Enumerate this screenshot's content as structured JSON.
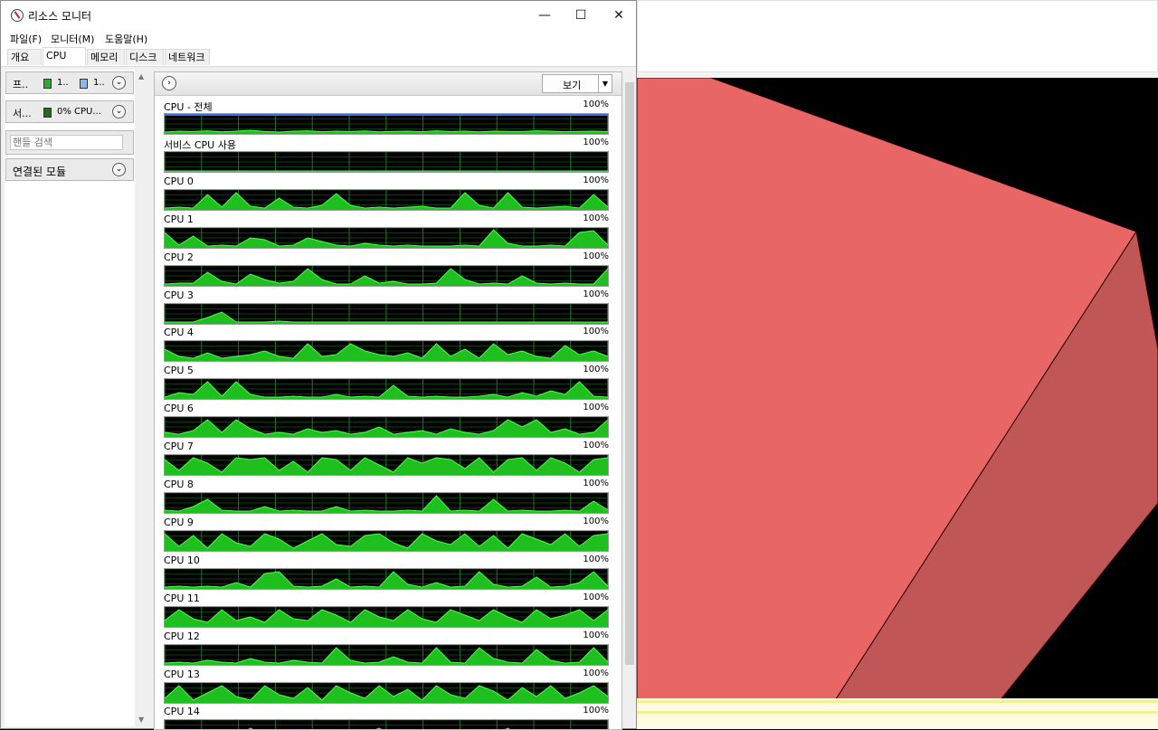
{
  "window": {
    "title": "리소스 모니터",
    "minimize_glyph": "—",
    "maximize_glyph": "☐",
    "close_glyph": "✕"
  },
  "menu": [
    "파일(F)",
    "모니터(M)",
    "도움말(H)"
  ],
  "tabs": [
    {
      "label": "개요",
      "active": false
    },
    {
      "label": "CPU",
      "active": true
    },
    {
      "label": "메모리",
      "active": false
    },
    {
      "label": "디스크",
      "active": false
    },
    {
      "label": "네트워크",
      "active": false
    }
  ],
  "left_panel": {
    "processes": {
      "label": "프..",
      "value1": "1..",
      "value2": "1..",
      "color1": "#2dab2d",
      "color2": "#8ab9f0"
    },
    "services": {
      "label": "서...",
      "value": "0% CPU...",
      "color": "#1f6e1f"
    },
    "handle_search": {
      "placeholder": "핸들 검색"
    },
    "modules": {
      "label": "연결된 모듈"
    }
  },
  "graph_panel": {
    "view_label": "보기",
    "graphs": [
      {
        "title": "CPU - 전체",
        "max": "100%",
        "values": [
          0.05,
          0.1,
          0.08,
          0.12,
          0.06,
          0.1,
          0.15,
          0.08,
          0.05,
          0.1,
          0.12,
          0.07,
          0.1,
          0.08,
          0.11,
          0.06,
          0.09,
          0.1,
          0.07,
          0.12,
          0.08,
          0.1,
          0.06,
          0.1,
          0.09,
          0.08,
          0.12,
          0.1,
          0.07,
          0.09,
          0.1,
          0.08
        ],
        "overlay": true
      },
      {
        "title": "서비스 CPU 사용",
        "max": "100%",
        "values": [
          0,
          0,
          0,
          0,
          0,
          0,
          0,
          0,
          0,
          0,
          0,
          0,
          0,
          0,
          0,
          0,
          0,
          0,
          0,
          0,
          0,
          0,
          0,
          0,
          0,
          0,
          0,
          0,
          0,
          0,
          0,
          0
        ]
      },
      {
        "title": "CPU 0",
        "max": "100%",
        "values": [
          0.05,
          0.1,
          0.05,
          0.8,
          0.1,
          0.9,
          0.15,
          0.05,
          0.6,
          0.1,
          0.05,
          0.2,
          0.85,
          0.2,
          0.05,
          0.1,
          0.05,
          0.1,
          0.15,
          0.05,
          0.05,
          0.9,
          0.2,
          0.05,
          0.9,
          0.1,
          0.05,
          0.1,
          0.15,
          0.05,
          0.8,
          0.1
        ]
      },
      {
        "title": "CPU 1",
        "max": "100%",
        "values": [
          0.8,
          0.1,
          0.6,
          0.05,
          0.1,
          0.05,
          0.5,
          0.4,
          0.05,
          0.1,
          0.5,
          0.3,
          0.1,
          0.05,
          0.2,
          0.1,
          0.05,
          0.1,
          0.05,
          0.05,
          0.05,
          0.1,
          0.05,
          0.95,
          0.2,
          0.05,
          0.05,
          0.1,
          0.05,
          0.8,
          0.9,
          0.1
        ]
      },
      {
        "title": "CPU 2",
        "max": "100%",
        "values": [
          0.05,
          0.1,
          0.1,
          0.7,
          0.2,
          0.05,
          0.6,
          0.3,
          0.1,
          0.2,
          0.9,
          0.3,
          0.05,
          0.05,
          0.5,
          0.1,
          0.2,
          0.05,
          0.05,
          0.1,
          0.9,
          0.3,
          0.05,
          0.1,
          0.05,
          0.5,
          0.1,
          0.05,
          0.1,
          0.05,
          0.05,
          0.9
        ]
      },
      {
        "title": "CPU 3",
        "max": "100%",
        "values": [
          0.05,
          0.05,
          0.05,
          0.3,
          0.6,
          0.05,
          0.05,
          0.05,
          0.1,
          0.05,
          0.05,
          0.05,
          0.05,
          0.05,
          0.05,
          0.05,
          0.05,
          0.05,
          0.05,
          0.05,
          0.05,
          0.05,
          0.05,
          0.05,
          0.05,
          0.05,
          0.05,
          0.05,
          0.05,
          0.05,
          0.05,
          0.05
        ]
      },
      {
        "title": "CPU 4",
        "max": "100%",
        "values": [
          0.6,
          0.2,
          0.1,
          0.4,
          0.1,
          0.2,
          0.3,
          0.5,
          0.2,
          0.1,
          0.9,
          0.2,
          0.3,
          0.9,
          0.5,
          0.3,
          0.2,
          0.4,
          0.1,
          0.9,
          0.2,
          0.6,
          0.1,
          0.9,
          0.3,
          0.5,
          0.2,
          0.1,
          0.8,
          0.3,
          0.5,
          0.2
        ]
      },
      {
        "title": "CPU 5",
        "max": "100%",
        "values": [
          0.05,
          0.3,
          0.2,
          0.9,
          0.1,
          0.9,
          0.2,
          0.05,
          0.05,
          0.1,
          0.05,
          0.05,
          0.2,
          0.05,
          0.1,
          0.05,
          0.7,
          0.1,
          0.05,
          0.1,
          0.05,
          0.05,
          0.1,
          0.2,
          0.05,
          0.3,
          0.1,
          0.4,
          0.2,
          0.9,
          0.1,
          0.05
        ]
      },
      {
        "title": "CPU 6",
        "max": "100%",
        "values": [
          0.2,
          0.1,
          0.3,
          0.9,
          0.2,
          0.9,
          0.4,
          0.1,
          0.2,
          0.1,
          0.4,
          0.2,
          0.3,
          0.1,
          0.2,
          0.5,
          0.1,
          0.2,
          0.3,
          0.1,
          0.4,
          0.2,
          0.1,
          0.3,
          0.9,
          0.5,
          0.9,
          0.2,
          0.4,
          0.1,
          0.2,
          0.9
        ]
      },
      {
        "title": "CPU 7",
        "max": "100%",
        "values": [
          0.8,
          0.2,
          0.9,
          0.6,
          0.1,
          0.9,
          0.8,
          0.9,
          0.2,
          0.7,
          0.1,
          0.9,
          0.8,
          0.2,
          0.9,
          0.5,
          0.1,
          0.9,
          0.6,
          0.9,
          0.8,
          0.3,
          0.9,
          0.1,
          0.8,
          0.9,
          0.2,
          0.9,
          0.6,
          0.1,
          0.8,
          0.9
        ]
      },
      {
        "title": "CPU 8",
        "max": "100%",
        "values": [
          0.1,
          0.05,
          0.3,
          0.7,
          0.1,
          0.05,
          0.05,
          0.3,
          0.05,
          0.1,
          0.05,
          0.05,
          0.3,
          0.05,
          0.1,
          0.05,
          0.05,
          0.1,
          0.05,
          0.9,
          0.05,
          0.1,
          0.05,
          0.7,
          0.05,
          0.1,
          0.05,
          0.05,
          0.1,
          0.05,
          0.6,
          0.1
        ]
      },
      {
        "title": "CPU 9",
        "max": "100%",
        "values": [
          0.9,
          0.2,
          0.8,
          0.1,
          0.9,
          0.4,
          0.2,
          0.9,
          0.6,
          0.1,
          0.5,
          0.9,
          0.3,
          0.2,
          0.8,
          0.9,
          0.4,
          0.1,
          0.9,
          0.5,
          0.3,
          0.9,
          0.2,
          0.8,
          0.1,
          0.9,
          0.6,
          0.3,
          0.9,
          0.2,
          0.8,
          0.9
        ]
      },
      {
        "title": "CPU 10",
        "max": "100%",
        "values": [
          0.05,
          0.1,
          0.05,
          0.1,
          0.05,
          0.3,
          0.05,
          0.8,
          0.9,
          0.1,
          0.05,
          0.1,
          0.5,
          0.05,
          0.1,
          0.05,
          0.9,
          0.2,
          0.05,
          0.3,
          0.05,
          0.1,
          0.9,
          0.2,
          0.05,
          0.1,
          0.6,
          0.05,
          0.1,
          0.3,
          0.9,
          0.1
        ]
      },
      {
        "title": "CPU 11",
        "max": "100%",
        "values": [
          0.3,
          0.9,
          0.4,
          0.2,
          0.9,
          0.3,
          0.5,
          0.2,
          0.9,
          0.4,
          0.3,
          0.9,
          0.6,
          0.2,
          0.9,
          0.5,
          0.3,
          0.9,
          0.4,
          0.2,
          0.9,
          0.6,
          0.3,
          0.9,
          0.5,
          0.2,
          0.9,
          0.4,
          0.6,
          0.9,
          0.3,
          0.9
        ]
      },
      {
        "title": "CPU 12",
        "max": "100%",
        "values": [
          0.05,
          0.1,
          0.05,
          0.2,
          0.1,
          0.05,
          0.3,
          0.1,
          0.05,
          0.2,
          0.1,
          0.05,
          0.9,
          0.2,
          0.05,
          0.1,
          0.4,
          0.1,
          0.05,
          0.9,
          0.1,
          0.05,
          0.9,
          0.3,
          0.1,
          0.05,
          0.8,
          0.2,
          0.05,
          0.1,
          0.9,
          0.1
        ]
      },
      {
        "title": "CPU 13",
        "max": "100%",
        "values": [
          0.2,
          0.9,
          0.1,
          0.5,
          0.9,
          0.3,
          0.1,
          0.9,
          0.4,
          0.2,
          0.8,
          0.1,
          0.9,
          0.5,
          0.2,
          0.9,
          0.3,
          0.7,
          0.1,
          0.9,
          0.4,
          0.2,
          0.9,
          0.6,
          0.1,
          0.8,
          0.3,
          0.9,
          0.2,
          0.5,
          0.9,
          0.3
        ]
      },
      {
        "title": "CPU 14",
        "max": "100%",
        "values": [
          0.1,
          0.3,
          0.5,
          0.2,
          0.4,
          0.1,
          0.6,
          0.2,
          0.3,
          0.1,
          0.5,
          0.2,
          0.4,
          0.1,
          0.3,
          0.6,
          0.2,
          0.1,
          0.4,
          0.2,
          0.5,
          0.1,
          0.3,
          0.2,
          0.6,
          0.1,
          0.4,
          0.3,
          0.2,
          0.5,
          0.1,
          0.3
        ]
      }
    ]
  },
  "colors": {
    "graph_fill": "#1fbf1f",
    "graph_line": "#4cff4c",
    "graph_grid": "#1f7a1f",
    "overlay_line": "#3a6fe0",
    "scene_red": "#e96666",
    "scene_red_dark": "#c05656",
    "scene_black": "#000000"
  }
}
